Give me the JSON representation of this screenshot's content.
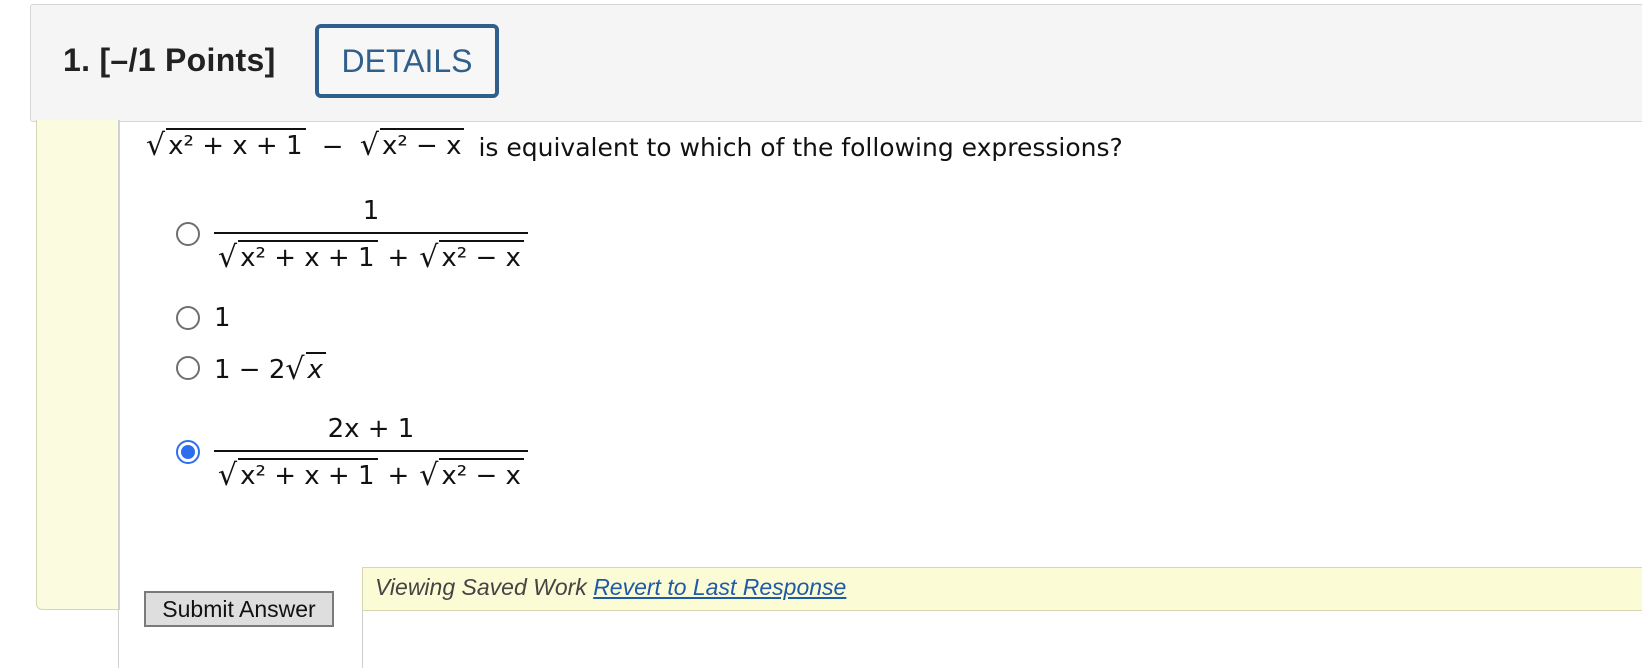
{
  "header": {
    "question_label": "1. [–/1 Points]",
    "details_label": "DETAILS"
  },
  "question": {
    "prompt_text": "is equivalent to which of the following expressions?",
    "expr_left_radicand": "x² + x + 1",
    "expr_op": "−",
    "expr_right_radicand": "x² − x"
  },
  "options": [
    {
      "numerator": "1",
      "denominator_left": "x² + x + 1",
      "denominator_op": "+",
      "denominator_right": "x² − x",
      "selected": false
    },
    {
      "text": "1",
      "selected": false
    },
    {
      "prefix": "1 − 2",
      "radicand": "x",
      "selected": false
    },
    {
      "numerator": "2x + 1",
      "denominator_left": "x² + x + 1",
      "denominator_op": "+",
      "denominator_right": "x² − x",
      "selected": true
    }
  ],
  "footer": {
    "submit_label": "Submit Answer",
    "viewing_text": "Viewing Saved Work",
    "revert_label": "Revert to Last Response"
  },
  "colors": {
    "accent": "#2f5f8a",
    "radio_selected": "#2d6ef0",
    "sidebar_bg": "#fbfbdf",
    "link": "#1f5aa6"
  }
}
